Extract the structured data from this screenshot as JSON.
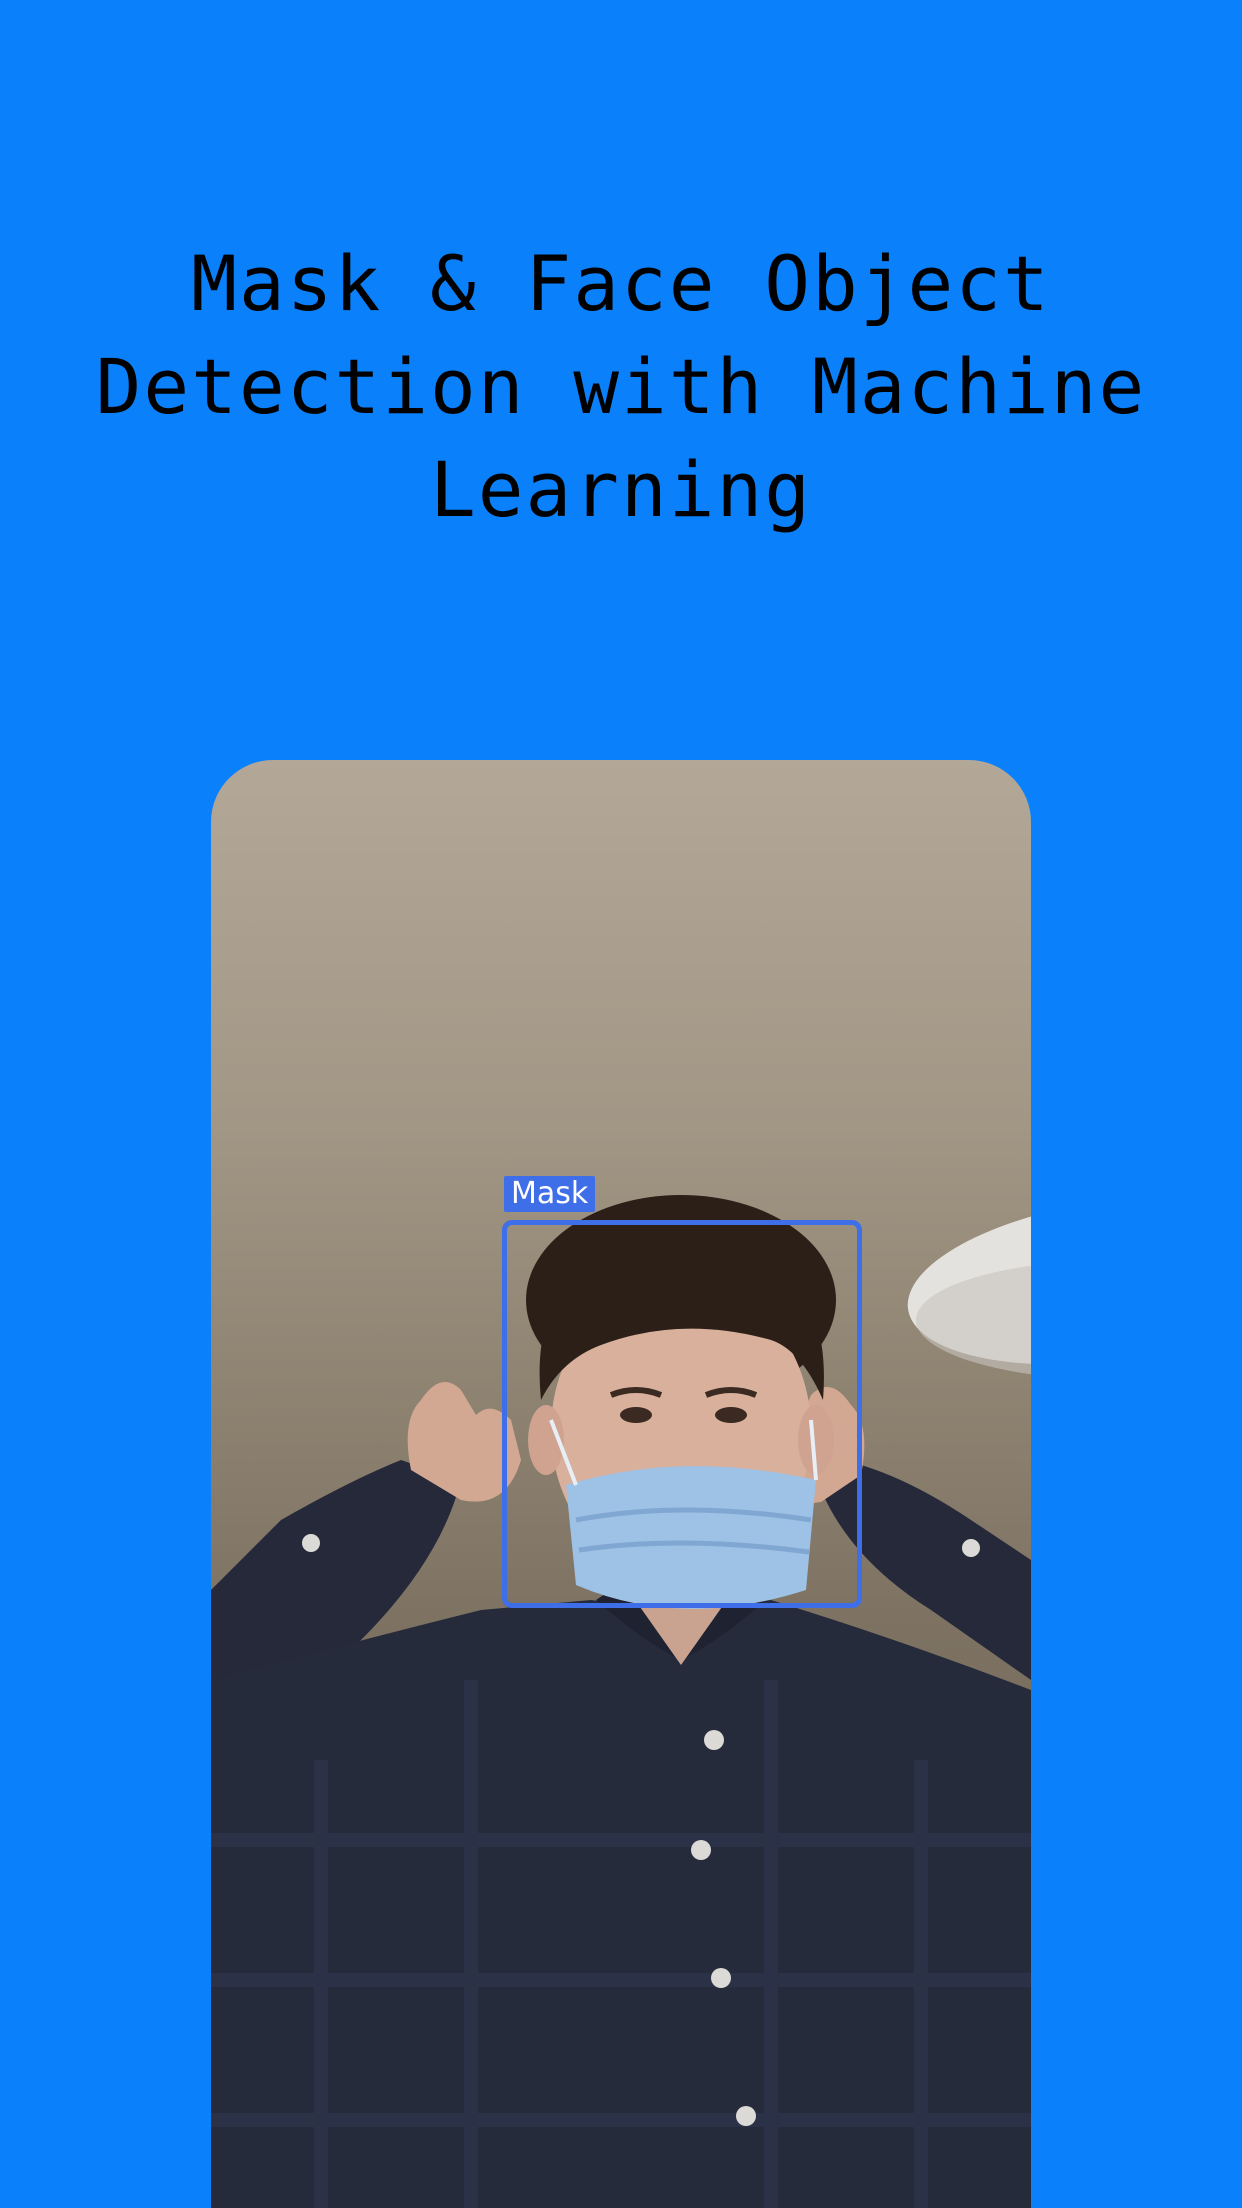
{
  "title": "Mask & Face Object Detection with Machine Learning",
  "colors": {
    "background": "#0b80fb",
    "detection_box": "#3e6fe8"
  },
  "preview": {
    "image": "camera-preview-person-wearing-mask",
    "detection": {
      "label": "Mask"
    }
  }
}
